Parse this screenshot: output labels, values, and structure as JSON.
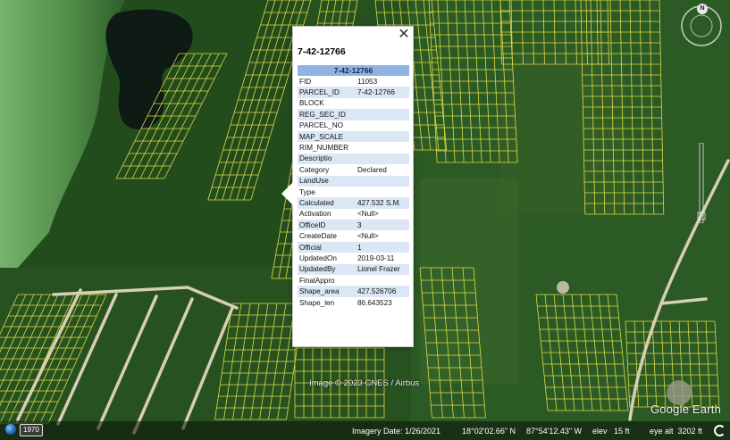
{
  "colors": {
    "parcel_line": "#e8e24a",
    "road": "#d7cfb4",
    "forest": "#27521f",
    "water": "#0e1a14",
    "lagoon": "#6aa560",
    "popup_header": "#8fb4e3",
    "popup_alt_row": "#dbe7f5"
  },
  "popup": {
    "title": "7-42-12766",
    "close_icon": "close-icon",
    "table_header": "7-42-12766",
    "rows": [
      {
        "key": "FID",
        "value": "11053"
      },
      {
        "key": "PARCEL_ID",
        "value": "7-42-12766"
      },
      {
        "key": "BLOCK",
        "value": ""
      },
      {
        "key": "REG_SEC_ID",
        "value": ""
      },
      {
        "key": "PARCEL_NO",
        "value": ""
      },
      {
        "key": "MAP_SCALE",
        "value": ""
      },
      {
        "key": "RIM_NUMBER",
        "value": ""
      },
      {
        "key": "Descriptio",
        "value": ""
      },
      {
        "key": "Category",
        "value": "Declared"
      },
      {
        "key": "LandUse",
        "value": ""
      },
      {
        "key": "Type",
        "value": ""
      },
      {
        "key": "Calculated",
        "value": "427.532 S.M."
      },
      {
        "key": "Activation",
        "value": "<Null>"
      },
      {
        "key": "OfficeID",
        "value": "3"
      },
      {
        "key": "CreateDate",
        "value": "<Null>"
      },
      {
        "key": "Official",
        "value": "1"
      },
      {
        "key": "UpdatedOn",
        "value": "2019-03-11"
      },
      {
        "key": "UpdatedBy",
        "value": "Lionel Frazer"
      },
      {
        "key": "FinalAppro",
        "value": ""
      },
      {
        "key": "Shape_area",
        "value": "427.526706"
      },
      {
        "key": "Shape_len",
        "value": "86.643523"
      }
    ]
  },
  "map": {
    "compass_label": "N",
    "copyright": "Image © 2023 CNES / Airbus",
    "logo": "Google Earth"
  },
  "status": {
    "year_badge": "1970",
    "imagery_date": "Imagery Date: 1/26/2021",
    "latitude": "18°02'02.66\" N",
    "longitude": "87°54'12.43\" W",
    "elev": "elev   15 ft",
    "eye_alt": "eye alt  3202 ft"
  }
}
